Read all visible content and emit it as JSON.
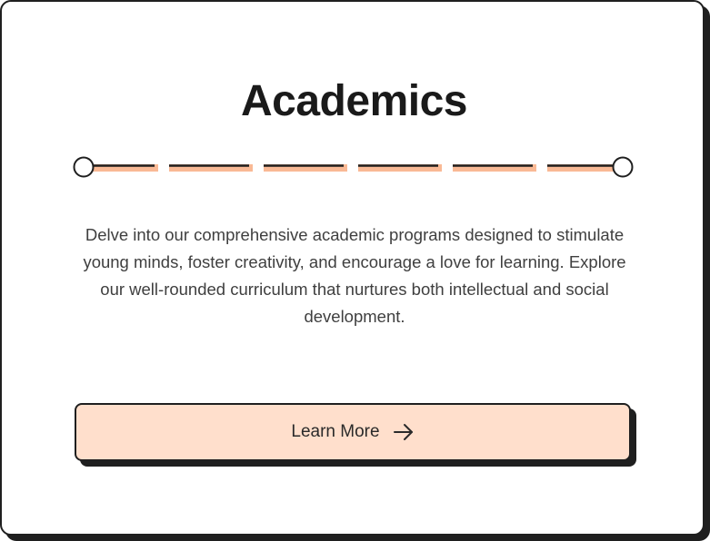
{
  "card": {
    "title": "Academics",
    "description": "Delve into our comprehensive academic programs designed to stimulate young minds, foster creativity, and encourage a love for learning. Explore our well-rounded curriculum that nurtures both intellectual and social development.",
    "cta": {
      "label": "Learn More",
      "icon": "arrow-right-icon"
    }
  },
  "colors": {
    "accent": "#ffdfcc",
    "dash_accent": "#f9b995",
    "ink": "#1f1f1f",
    "text": "#3f3f3f"
  }
}
